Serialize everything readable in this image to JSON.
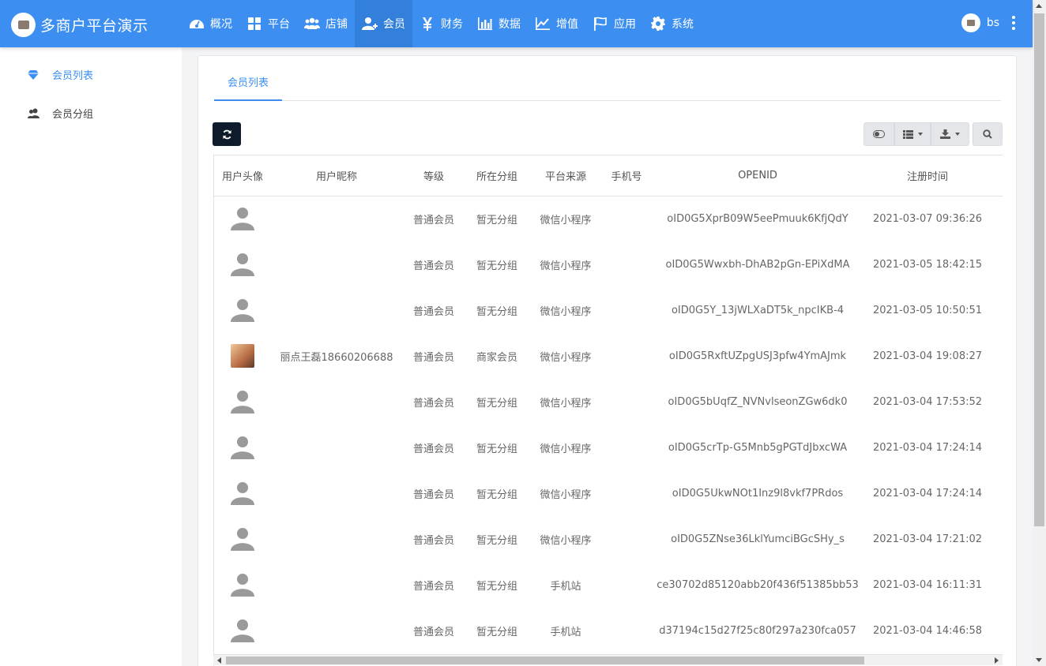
{
  "app": {
    "title": "多商户平台演示"
  },
  "nav": [
    {
      "label": "概况",
      "icon": "dashboard-icon",
      "active": false
    },
    {
      "label": "平台",
      "icon": "grid-icon",
      "active": false
    },
    {
      "label": "店铺",
      "icon": "users-icon",
      "active": false
    },
    {
      "label": "会员",
      "icon": "user-plus-icon",
      "active": true
    },
    {
      "label": "财务",
      "icon": "yen-icon",
      "active": false
    },
    {
      "label": "数据",
      "icon": "bar-chart-icon",
      "active": false
    },
    {
      "label": "增值",
      "icon": "line-chart-icon",
      "active": false
    },
    {
      "label": "应用",
      "icon": "flag-icon",
      "active": false
    },
    {
      "label": "系统",
      "icon": "gear-icon",
      "active": false
    }
  ],
  "user": {
    "name": "bs"
  },
  "sidebar": {
    "items": [
      {
        "label": "会员列表",
        "icon": "diamond-icon",
        "active": true
      },
      {
        "label": "会员分组",
        "icon": "user-group-icon",
        "active": false
      }
    ]
  },
  "main": {
    "tabs": [
      {
        "label": "会员列表"
      }
    ]
  },
  "table": {
    "columns": [
      "用户头像",
      "用户昵称",
      "等级",
      "所在分组",
      "平台来源",
      "手机号",
      "OPENID",
      "注册时间"
    ],
    "rows": [
      {
        "avatar": "default",
        "nickname": "",
        "level": "普通会员",
        "group": "暂无分组",
        "source": "微信小程序",
        "phone": "",
        "openid": "oID0G5XprB09W5eePmuuk6KfjQdY",
        "time": "2021-03-07 09:36:26"
      },
      {
        "avatar": "default",
        "nickname": "",
        "level": "普通会员",
        "group": "暂无分组",
        "source": "微信小程序",
        "phone": "",
        "openid": "oID0G5Wwxbh-DhAB2pGn-EPiXdMA",
        "time": "2021-03-05 18:42:15"
      },
      {
        "avatar": "default",
        "nickname": "",
        "level": "普通会员",
        "group": "暂无分组",
        "source": "微信小程序",
        "phone": "",
        "openid": "oID0G5Y_13jWLXaDT5k_npcIKB-4",
        "time": "2021-03-05 10:50:51"
      },
      {
        "avatar": "photo",
        "nickname": "丽点王磊18660206688",
        "level": "普通会员",
        "group": "商家会员",
        "source": "微信小程序",
        "phone": "",
        "openid": "oID0G5RxftUZpgUSJ3pfw4YmAJmk",
        "time": "2021-03-04 19:08:27"
      },
      {
        "avatar": "default",
        "nickname": "",
        "level": "普通会员",
        "group": "暂无分组",
        "source": "微信小程序",
        "phone": "",
        "openid": "oID0G5bUqfZ_NVNvlseonZGw6dk0",
        "time": "2021-03-04 17:53:52"
      },
      {
        "avatar": "default",
        "nickname": "",
        "level": "普通会员",
        "group": "暂无分组",
        "source": "微信小程序",
        "phone": "",
        "openid": "oID0G5crTp-G5Mnb5gPGTdJbxcWA",
        "time": "2021-03-04 17:24:14"
      },
      {
        "avatar": "default",
        "nickname": "",
        "level": "普通会员",
        "group": "暂无分组",
        "source": "微信小程序",
        "phone": "",
        "openid": "oID0G5UkwNOt1Inz9l8vkf7PRdos",
        "time": "2021-03-04 17:24:14"
      },
      {
        "avatar": "default",
        "nickname": "",
        "level": "普通会员",
        "group": "暂无分组",
        "source": "微信小程序",
        "phone": "",
        "openid": "oID0G5ZNse36LklYumciBGcSHy_s",
        "time": "2021-03-04 17:21:02"
      },
      {
        "avatar": "default",
        "nickname": "",
        "level": "普通会员",
        "group": "暂无分组",
        "source": "手机站",
        "phone": "",
        "openid": "ce30702d85120abb20f436f51385bb53",
        "time": "2021-03-04 16:11:31"
      },
      {
        "avatar": "default",
        "nickname": "",
        "level": "普通会员",
        "group": "暂无分组",
        "source": "手机站",
        "phone": "",
        "openid": "d37194c15d27f25c80f297a230fca057",
        "time": "2021-03-04 14:46:58"
      }
    ]
  },
  "colors": {
    "primary": "#3c8ff0",
    "active_nav": "#3280dc",
    "refresh_button": "#0d1b2a"
  }
}
